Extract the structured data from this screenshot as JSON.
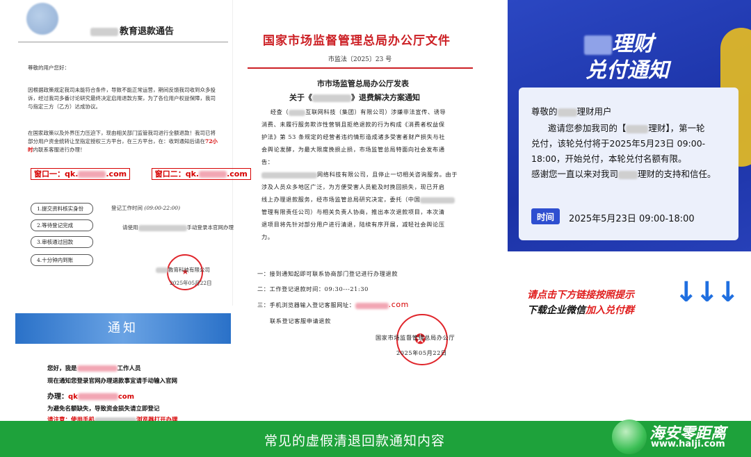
{
  "left_doc": {
    "title": "教育退款通告",
    "greeting": "尊敬的用户您好：",
    "para1": "因根据政策规定我司未能符合条件，导致不能正常运营，期间反馈我司收到众多投诉，经过我司多番讨论研究最终决定启用退款方案，为了各位用户权益保障，我司与指定三方（乙方）达成协议。",
    "para2": "在国家政策以及外界压力压迫下，现由相关部门监管我司进行全额退款！我司已将部分用户资金统转让至指定授权三方平台，在三方平台，在：收到通知后请在",
    "para2_em": "72小时",
    "para2_end": "内联系客服进行办理！",
    "window1_label": "窗口一：",
    "window1_value": "qk.",
    "window1_suffix": ".com",
    "window2_label": "窗口二：",
    "window2_value": "qk.",
    "window2_suffix": ".com",
    "steps": [
      "1.提交资料核实身份",
      "2.等待登记完成",
      "3.审核通过回款",
      "4.十分钟内到账"
    ],
    "hours_label": "登记工作时间",
    "hours_value": "(09:00-22:00)",
    "use_phone_prefix": "请使用",
    "use_phone_suffix": "手动登录本官网办理",
    "company": "教育科技有限公司",
    "date": "2025年05月22日"
  },
  "left_notice": {
    "banner": "通知",
    "line1_prefix": "您好，我是",
    "line1_suffix": "工作人员",
    "line2": "现在通知您登录官网办理退款事宜请手动输入官网",
    "line3_prefix": "办理：",
    "line3_value": "qk",
    "line3_suffix": "com",
    "line4": "为避免名额缺失，导致资金损失请立即登记",
    "line5_prefix": "请注意：使用手机",
    "line5_suffix": "浏览器打开办理"
  },
  "mid_doc": {
    "header": "国家市场监督管理总局办公厅文件",
    "doc_number": "市监法〔2025〕23 号",
    "subheader": "市市场监管总局办公厅发表",
    "title_prefix": "关于《",
    "title_suffix": "》退费解决方案通知",
    "body_lines": [
      "互联网科技（集团）有限公司）涉嫌非法宣传、诱导",
      "消费、未履行服务欺诈性营销且拒绝退款的行为构成《消费者权益保",
      "护法》第 53 条规定的经营者违约情形造成诸多受害者财产损失与社",
      "会舆论发酵，为最大限度挽损止损，市场监管总局特面向社会发布通",
      "告：",
      "网络科技有限公司，且停止一切相关咨询服务。由于",
      "涉及人员众多地区广泛，为方便受害人员能及时挽回损失，现已开启",
      "线上办理退款服务，经市场监管总局研究决定，委托（中国",
      "管理有限责任公司）与相关负责人协商，推出本次退款项目，本次清",
      "退项目将先针对部分用户进行清退，陆续有序开展，减轻社会舆论压",
      "力。"
    ],
    "body_first_prefix": "经查（",
    "item1": "一：接到通知起即可联系协商部门登记进行办理退款",
    "item2": "二：工作登记退款时间：09:30---21:30",
    "item3_prefix": "三：手机浏览器输入登记客服网址：",
    "item3_suffix": ".com",
    "item4": "联系登记客服申请退款",
    "sign_org": "国家市场监督管理总局办公厅",
    "sign_date": "2025年05月22日"
  },
  "right_card": {
    "title_line1": "理财",
    "title_line2": "兑付通知",
    "salutation_prefix": "尊敬的",
    "salutation_suffix": "理财用户",
    "p1_a": "邀请您参加我司的【",
    "p1_b": "理财】，第一轮",
    "p1_c": "兑付，该轮兑付将于2025年5月23日 09:00-",
    "p1_d": "18:00，开始兑付，本轮兑付名额有限。",
    "p2_a": "感谢您一直以来对我司",
    "p2_b": "理财的支持和信任。",
    "time_label": "时间",
    "time_value": "2025年5月23日   09:00-18:00",
    "cta_line1": "请点击下方链接按照提示",
    "cta_line2_a": "下载企业微信",
    "cta_line2_b": "加入兑付群",
    "arrows": [
      "↓",
      "↓",
      "↓"
    ]
  },
  "footer": {
    "caption": "常见的虚假清退回款通知内容",
    "brand_name": "海安零距离",
    "brand_url": "www.halji.com"
  },
  "colors": {
    "footer_green": "#1ea23b",
    "doc_red": "#cc1f24",
    "card_blue": "#2b47c2",
    "arrow_blue": "#1f6fe0"
  }
}
